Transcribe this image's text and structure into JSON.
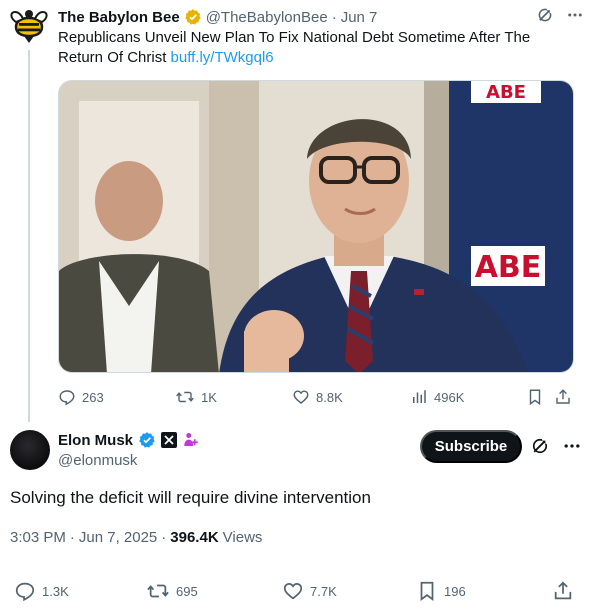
{
  "parent_tweet": {
    "author_name": "The Babylon Bee",
    "handle": "@TheBabylonBee",
    "separator": "·",
    "date": "Jun 7",
    "text": "Republicans Unveil New Plan To Fix National Debt Sometime After The Return Of Christ",
    "link": "buff.ly/TWkgql6",
    "stats": {
      "replies": "263",
      "reposts": "1K",
      "likes": "8.8K",
      "views": "496K"
    }
  },
  "main_tweet": {
    "author_name": "Elon Musk",
    "handle": "@elonmusk",
    "subscribe_label": "Subscribe",
    "text": "Solving the deficit will require divine intervention",
    "time": "3:03 PM",
    "separator": "·",
    "date": "Jun 7, 2025",
    "views_count": "396.4K",
    "views_label": "Views",
    "stats": {
      "replies": "1.3K",
      "reposts": "695",
      "likes": "7.7K",
      "bookmarks": "196"
    }
  },
  "colors": {
    "accent": "#1d9bf0",
    "gold_badge": "#e8b200",
    "secondary_text": "#536471"
  }
}
